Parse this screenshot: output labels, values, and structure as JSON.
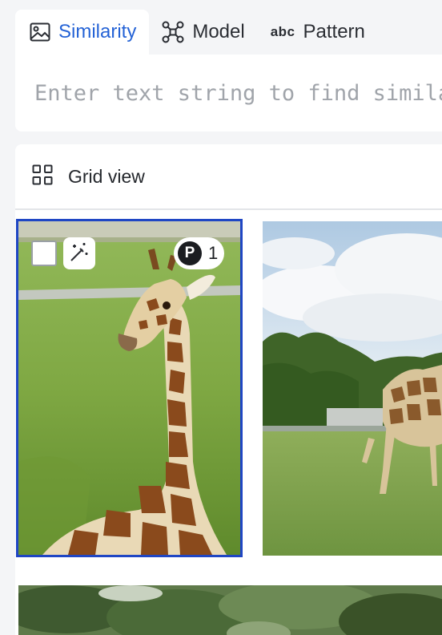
{
  "tabs": [
    {
      "label": "Similarity",
      "icon": "image-icon",
      "active": true
    },
    {
      "label": "Model",
      "icon": "model-graph-icon",
      "active": false
    },
    {
      "label": "Pattern",
      "icon": "abc-icon",
      "icon_text": "abc",
      "active": false
    }
  ],
  "search": {
    "placeholder": "Enter text string to find similar",
    "value": ""
  },
  "grid": {
    "view_label": "Grid view",
    "view_icon": "grid-icon"
  },
  "images": [
    {
      "description": "Giraffe sitting in green grass",
      "selected": true,
      "badge_letter": "P",
      "badge_count": "1",
      "border_color": "#1f46c4"
    },
    {
      "description": "Giraffe standing in grassy field with trees",
      "selected": false
    },
    {
      "description": "Tree canopy",
      "selected": false
    }
  ],
  "colors": {
    "accent": "#2563d6",
    "selection": "#1f46c4",
    "background": "#f4f5f7"
  }
}
